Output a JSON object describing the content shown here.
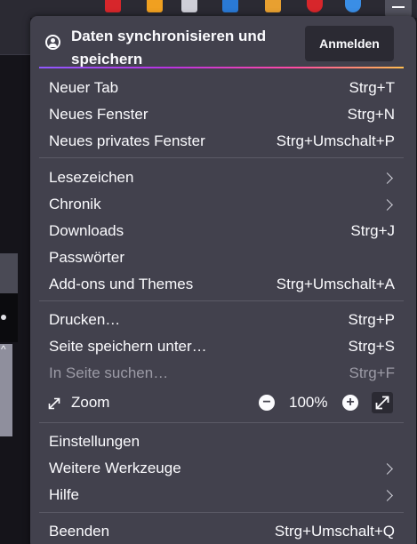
{
  "sync": {
    "title": "Daten synchronisieren und speichern",
    "signin_label": "Anmelden"
  },
  "group1": [
    {
      "label": "Neuer Tab",
      "shortcut": "Strg+T"
    },
    {
      "label": "Neues Fenster",
      "shortcut": "Strg+N"
    },
    {
      "label": "Neues privates Fenster",
      "shortcut": "Strg+Umschalt+P"
    }
  ],
  "group2": [
    {
      "label": "Lesezeichen"
    },
    {
      "label": "Chronik"
    },
    {
      "label": "Downloads",
      "shortcut": "Strg+J"
    },
    {
      "label": "Passwörter"
    },
    {
      "label": "Add-ons und Themes",
      "shortcut": "Strg+Umschalt+A"
    }
  ],
  "group3": [
    {
      "label": "Drucken…",
      "shortcut": "Strg+P"
    },
    {
      "label": "Seite speichern unter…",
      "shortcut": "Strg+S"
    },
    {
      "label": "In Seite suchen…",
      "shortcut": "Strg+F",
      "disabled": true
    }
  ],
  "zoom": {
    "label": "Zoom",
    "value": "100%",
    "minus": "−",
    "plus": "+"
  },
  "group4": [
    {
      "label": "Einstellungen"
    },
    {
      "label": "Weitere Werkzeuge"
    },
    {
      "label": "Hilfe"
    }
  ],
  "group5": [
    {
      "label": "Beenden",
      "shortcut": "Strg+Umschalt+Q"
    }
  ],
  "icons": {
    "account": "account-icon",
    "submenu": "chevron-right-icon",
    "zoom": "zoom-arrows-icon",
    "fullscreen": "fullscreen-icon",
    "menu": "hamburger-menu-icon"
  },
  "colors": {
    "panel_bg": "#42414d",
    "text": "#fbfbfe",
    "disabled_text": "#9c9ba6",
    "button_bg": "#2b2a33",
    "separator": "#5b5a66"
  }
}
